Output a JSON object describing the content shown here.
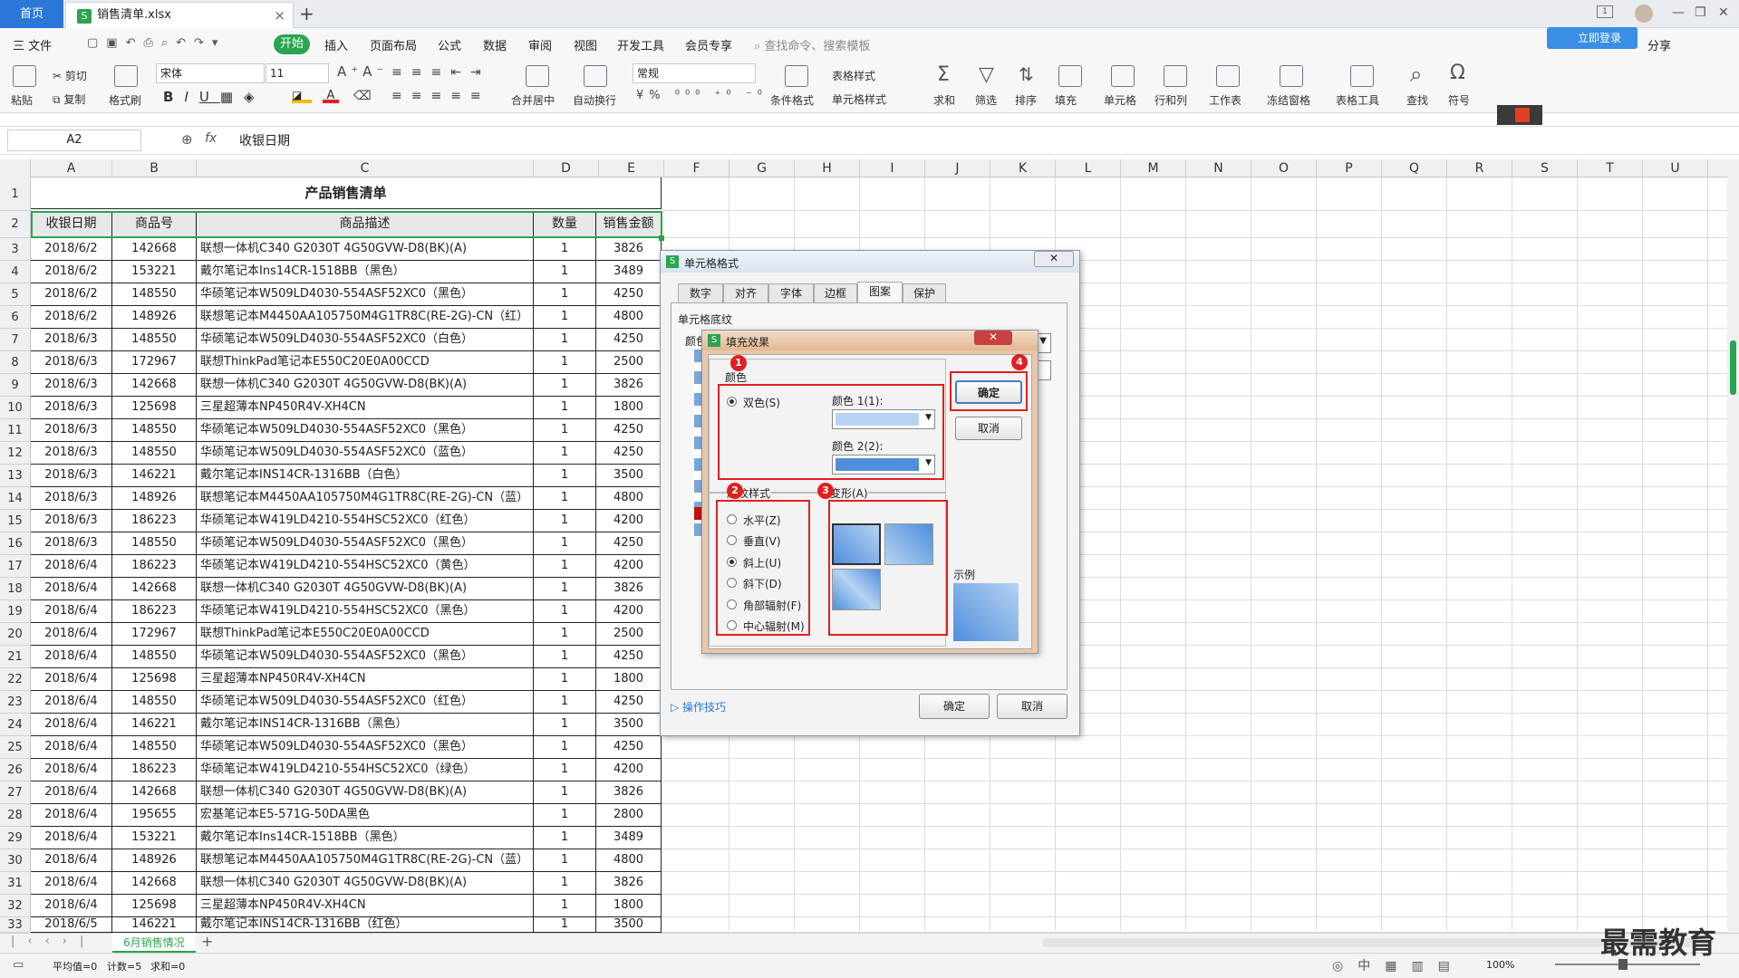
{
  "tabs": {
    "home": "首页",
    "file": "销售清单.xlsx",
    "new": "+"
  },
  "menu": {
    "file": "三 文件",
    "items": [
      "插入",
      "页面布局",
      "公式",
      "数据",
      "审阅",
      "视图",
      "开发工具",
      "会员专享"
    ],
    "start": "开始",
    "search": "查找命令、搜索模板",
    "login": "立即登录",
    "share": "分享"
  },
  "ribbon": {
    "paste": "粘贴",
    "cut": "剪切",
    "copy": "复制",
    "format_painter": "格式刷",
    "font": "宋体",
    "size": "11",
    "merge": "合并居中",
    "wrap": "自动换行",
    "numfmt": "常规",
    "cond": "条件格式",
    "table_style": "表格样式",
    "cell_style": "单元格样式",
    "sum": "求和",
    "filter": "筛选",
    "sort": "排序",
    "fill": "填充",
    "cell": "单元格",
    "rowcol": "行和列",
    "sheet": "工作表",
    "freeze": "冻结窗格",
    "tools": "表格工具",
    "find": "查找",
    "symbol": "符号"
  },
  "formula": {
    "cell_ref": "A2",
    "fx": "fx",
    "content": "收银日期"
  },
  "columns": [
    "A",
    "B",
    "C",
    "D",
    "E",
    "F",
    "G",
    "H",
    "I",
    "J",
    "K",
    "L",
    "M",
    "N",
    "O",
    "P",
    "Q",
    "R",
    "S",
    "T",
    "U"
  ],
  "sheet_title": "产品销售清单",
  "headers": [
    "收银日期",
    "商品号",
    "商品描述",
    "数量",
    "销售金额"
  ],
  "rows": [
    [
      "2018/6/2",
      "142668",
      "联想一体机C340 G2030T 4G50GVW-D8(BK)(A)",
      "1",
      "3826"
    ],
    [
      "2018/6/2",
      "153221",
      "戴尔笔记本Ins14CR-1518BB（黑色）",
      "1",
      "3489"
    ],
    [
      "2018/6/2",
      "148550",
      "华硕笔记本W509LD4030-554ASF52XC0（黑色）",
      "1",
      "4250"
    ],
    [
      "2018/6/2",
      "148926",
      "联想笔记本M4450AA105750M4G1TR8C(RE-2G)-CN（红）",
      "1",
      "4800"
    ],
    [
      "2018/6/3",
      "148550",
      "华硕笔记本W509LD4030-554ASF52XC0（白色）",
      "1",
      "4250"
    ],
    [
      "2018/6/3",
      "172967",
      "联想ThinkPad笔记本E550C20E0A00CCD",
      "1",
      "2500"
    ],
    [
      "2018/6/3",
      "142668",
      "联想一体机C340 G2030T 4G50GVW-D8(BK)(A)",
      "1",
      "3826"
    ],
    [
      "2018/6/3",
      "125698",
      "三星超薄本NP450R4V-XH4CN",
      "1",
      "1800"
    ],
    [
      "2018/6/3",
      "148550",
      "华硕笔记本W509LD4030-554ASF52XC0（黑色）",
      "1",
      "4250"
    ],
    [
      "2018/6/3",
      "148550",
      "华硕笔记本W509LD4030-554ASF52XC0（蓝色）",
      "1",
      "4250"
    ],
    [
      "2018/6/3",
      "146221",
      "戴尔笔记本INS14CR-1316BB（白色）",
      "1",
      "3500"
    ],
    [
      "2018/6/3",
      "148926",
      "联想笔记本M4450AA105750M4G1TR8C(RE-2G)-CN（蓝）",
      "1",
      "4800"
    ],
    [
      "2018/6/3",
      "186223",
      "华硕笔记本W419LD4210-554HSC52XC0（红色）",
      "1",
      "4200"
    ],
    [
      "2018/6/3",
      "148550",
      "华硕笔记本W509LD4030-554ASF52XC0（黑色）",
      "1",
      "4250"
    ],
    [
      "2018/6/4",
      "186223",
      "华硕笔记本W419LD4210-554HSC52XC0（黄色）",
      "1",
      "4200"
    ],
    [
      "2018/6/4",
      "142668",
      "联想一体机C340 G2030T 4G50GVW-D8(BK)(A)",
      "1",
      "3826"
    ],
    [
      "2018/6/4",
      "186223",
      "华硕笔记本W419LD4210-554HSC52XC0（黑色）",
      "1",
      "4200"
    ],
    [
      "2018/6/4",
      "172967",
      "联想ThinkPad笔记本E550C20E0A00CCD",
      "1",
      "2500"
    ],
    [
      "2018/6/4",
      "148550",
      "华硕笔记本W509LD4030-554ASF52XC0（黑色）",
      "1",
      "4250"
    ],
    [
      "2018/6/4",
      "125698",
      "三星超薄本NP450R4V-XH4CN",
      "1",
      "1800"
    ],
    [
      "2018/6/4",
      "148550",
      "华硕笔记本W509LD4030-554ASF52XC0（红色）",
      "1",
      "4250"
    ],
    [
      "2018/6/4",
      "146221",
      "戴尔笔记本INS14CR-1316BB（黑色）",
      "1",
      "3500"
    ],
    [
      "2018/6/4",
      "148550",
      "华硕笔记本W509LD4030-554ASF52XC0（黑色）",
      "1",
      "4250"
    ],
    [
      "2018/6/4",
      "186223",
      "华硕笔记本W419LD4210-554HSC52XC0（绿色）",
      "1",
      "4200"
    ],
    [
      "2018/6/4",
      "142668",
      "联想一体机C340 G2030T 4G50GVW-D8(BK)(A)",
      "1",
      "3826"
    ],
    [
      "2018/6/4",
      "195655",
      "宏基笔记本E5-571G-50DA黑色",
      "1",
      "2800"
    ],
    [
      "2018/6/4",
      "153221",
      "戴尔笔记本Ins14CR-1518BB（黑色）",
      "1",
      "3489"
    ],
    [
      "2018/6/4",
      "148926",
      "联想笔记本M4450AA105750M4G1TR8C(RE-2G)-CN（蓝）",
      "1",
      "4800"
    ],
    [
      "2018/6/4",
      "142668",
      "联想一体机C340 G2030T 4G50GVW-D8(BK)(A)",
      "1",
      "3826"
    ],
    [
      "2018/6/4",
      "125698",
      "三星超薄本NP450R4V-XH4CN",
      "1",
      "1800"
    ],
    [
      "2018/6/5",
      "146221",
      "戴尔笔记本INS14CR-1316BB（红色）",
      "1",
      "3500"
    ]
  ],
  "format_dialog": {
    "title": "单元格格式",
    "tabs": [
      "数字",
      "对齐",
      "字体",
      "边框",
      "图案",
      "保护"
    ],
    "section": "单元格底纹",
    "color_short": "颜色",
    "tips": "操作技巧",
    "ok": "确定",
    "cancel": "取消"
  },
  "fill_dialog": {
    "title": "填充效果",
    "color_group": "颜色",
    "two_color": "双色(S)",
    "color1": "颜色 1(1):",
    "color2": "颜色 2(2):",
    "shading_group": "底纹样式",
    "styles": [
      "水平(Z)",
      "垂直(V)",
      "斜上(U)",
      "斜下(D)",
      "角部辐射(F)",
      "中心辐射(M)"
    ],
    "variants": "变形(A)",
    "sample": "示例",
    "ok": "确定",
    "cancel": "取消",
    "badges": [
      "1",
      "2",
      "3",
      "4"
    ]
  },
  "sheet_tab": "6月销售情况",
  "status": {
    "avg": "平均值=0",
    "count": "计数=5",
    "sum": "求和=0",
    "zoom": "100%"
  },
  "watermark": "最需教育",
  "colors": {
    "accent": "#2aa44f",
    "highlight": "#e02020",
    "fill1": "#b7d3f2",
    "fill2": "#4f8fdc"
  }
}
